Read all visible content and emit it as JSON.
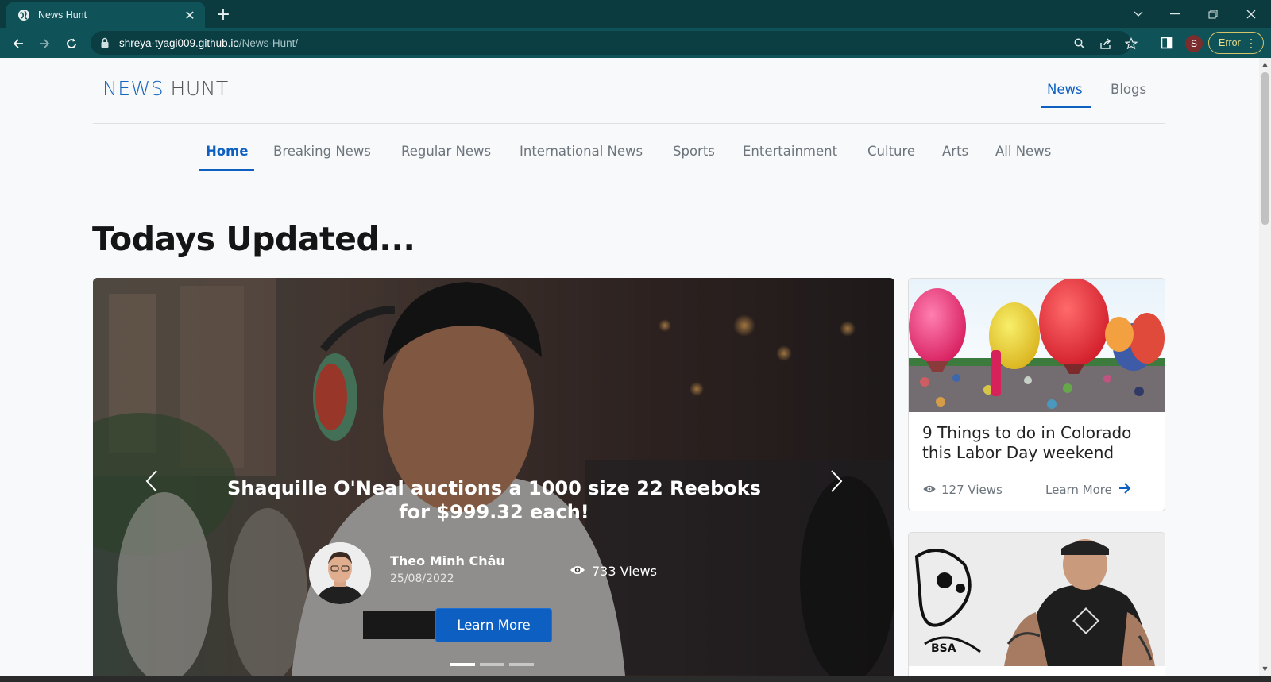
{
  "browser": {
    "tab_title": "News Hunt",
    "url_host": "shreya-tyagi009.github.io",
    "url_path": "/News-Hunt/",
    "profile_initial": "S",
    "error_label": "Error"
  },
  "site": {
    "brand_part1": "NEWS",
    "brand_part2": "HUNT",
    "top_nav": [
      "News",
      "Blogs"
    ],
    "categories": [
      "Home",
      "Breaking News",
      "Regular News",
      "International News",
      "Sports",
      "Entertainment",
      "Culture",
      "Arts",
      "All News"
    ],
    "heading": "Todays Updated..."
  },
  "featured": {
    "title": "Shaquille O'Neal auctions a 1000 size 22 Reeboks for $999.32 each!",
    "author": "Theo Minh Châu",
    "date": "25/08/2022",
    "views": "733 Views",
    "cta": "Learn More"
  },
  "cards": [
    {
      "title": "9 Things to do in Colorado this Labor Day weekend",
      "views": "127 Views",
      "cta": "Learn More"
    }
  ],
  "colors": {
    "accent": "#0d5fc1",
    "chrome_dark": "#0b3a3f",
    "chrome": "#0f5258"
  }
}
